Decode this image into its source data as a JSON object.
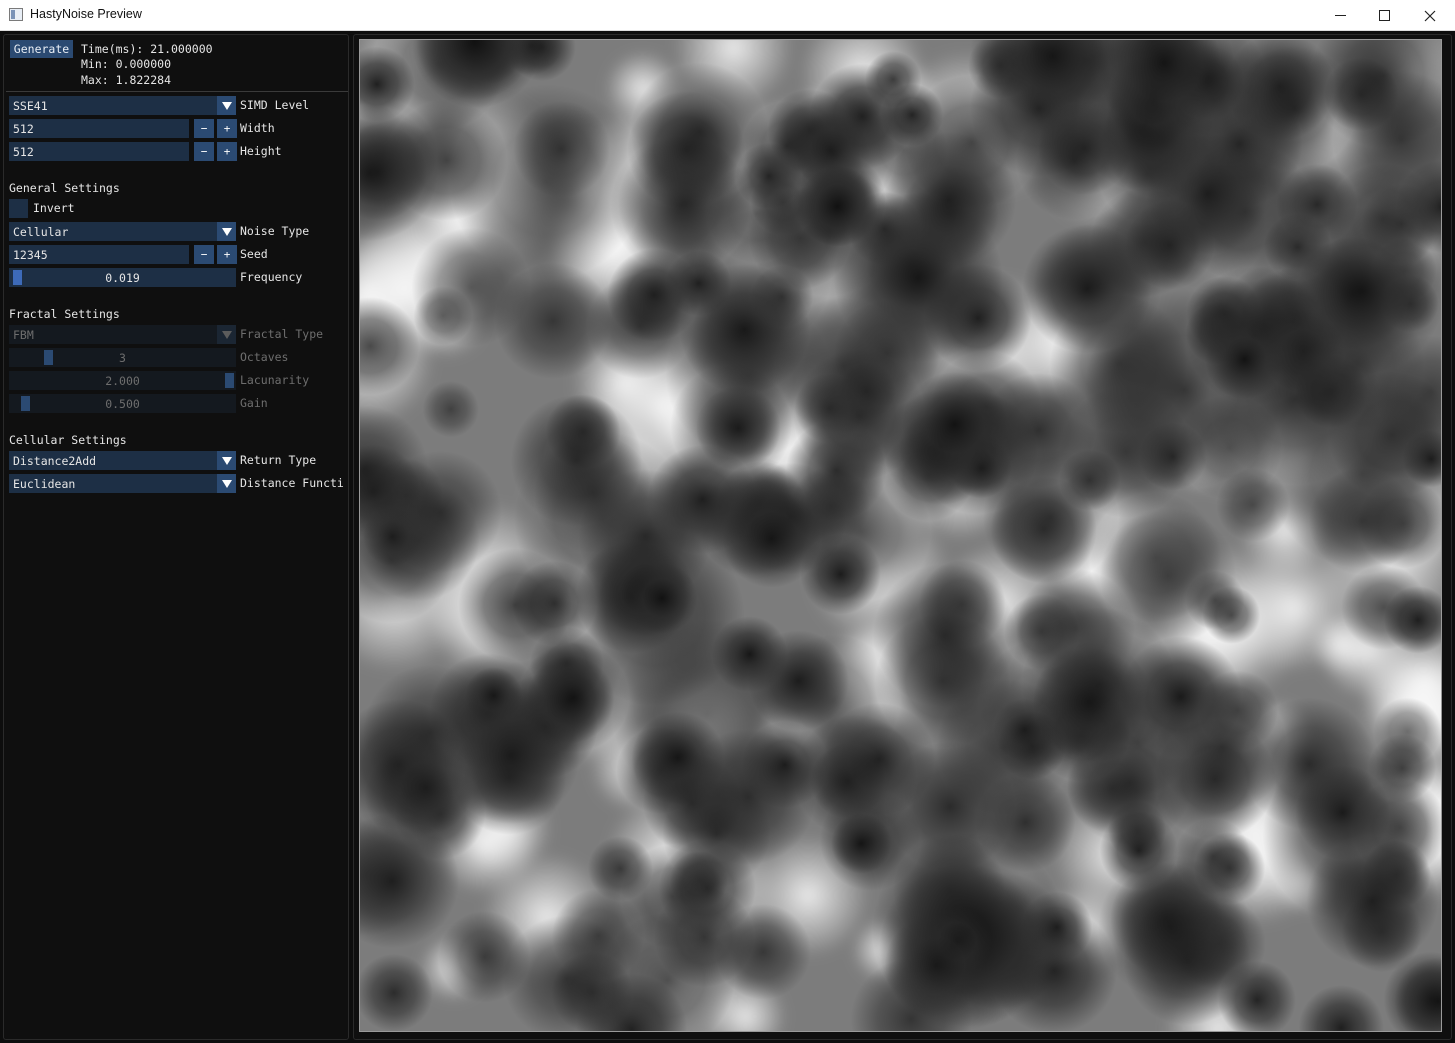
{
  "window": {
    "title": "HastyNoise Preview",
    "controls": [
      "minimize",
      "maximize",
      "close"
    ]
  },
  "panel": {
    "generate_label": "Generate",
    "stats": {
      "time": "Time(ms): 21.000000",
      "min": "Min: 0.000000",
      "max": "Max: 1.822284"
    },
    "simd": {
      "value": "SSE41",
      "label": "SIMD Level"
    },
    "width": {
      "value": "512",
      "label": "Width",
      "minus": "−",
      "plus": "+"
    },
    "height": {
      "value": "512",
      "label": "Height",
      "minus": "−",
      "plus": "+"
    },
    "general": {
      "heading": "General Settings",
      "invert_label": "Invert",
      "invert_checked": false,
      "noise_type": {
        "value": "Cellular",
        "label": "Noise Type"
      },
      "seed": {
        "value": "12345",
        "label": "Seed",
        "minus": "−",
        "plus": "+"
      },
      "frequency": {
        "value": "0.019",
        "label": "Frequency",
        "level": 0.019
      }
    },
    "fractal": {
      "heading": "Fractal Settings",
      "fractal_type": {
        "value": "FBM",
        "label": "Fractal Type"
      },
      "octaves": {
        "value": "3",
        "label": "Octaves"
      },
      "lacunarity": {
        "value": "2.000",
        "label": "Lacunarity"
      },
      "gain": {
        "value": "0.500",
        "label": "Gain"
      }
    },
    "cellular": {
      "heading": "Cellular Settings",
      "return_type": {
        "value": "Distance2Add",
        "label": "Return Type"
      },
      "distance_function": {
        "value": "Euclidean",
        "label": "Distance Functi"
      }
    }
  },
  "preview": {
    "alt": "Cellular noise preview image",
    "colors": {
      "light": "#f4f4f4",
      "mid": "#7a7a7a",
      "dark": "#141414"
    }
  }
}
